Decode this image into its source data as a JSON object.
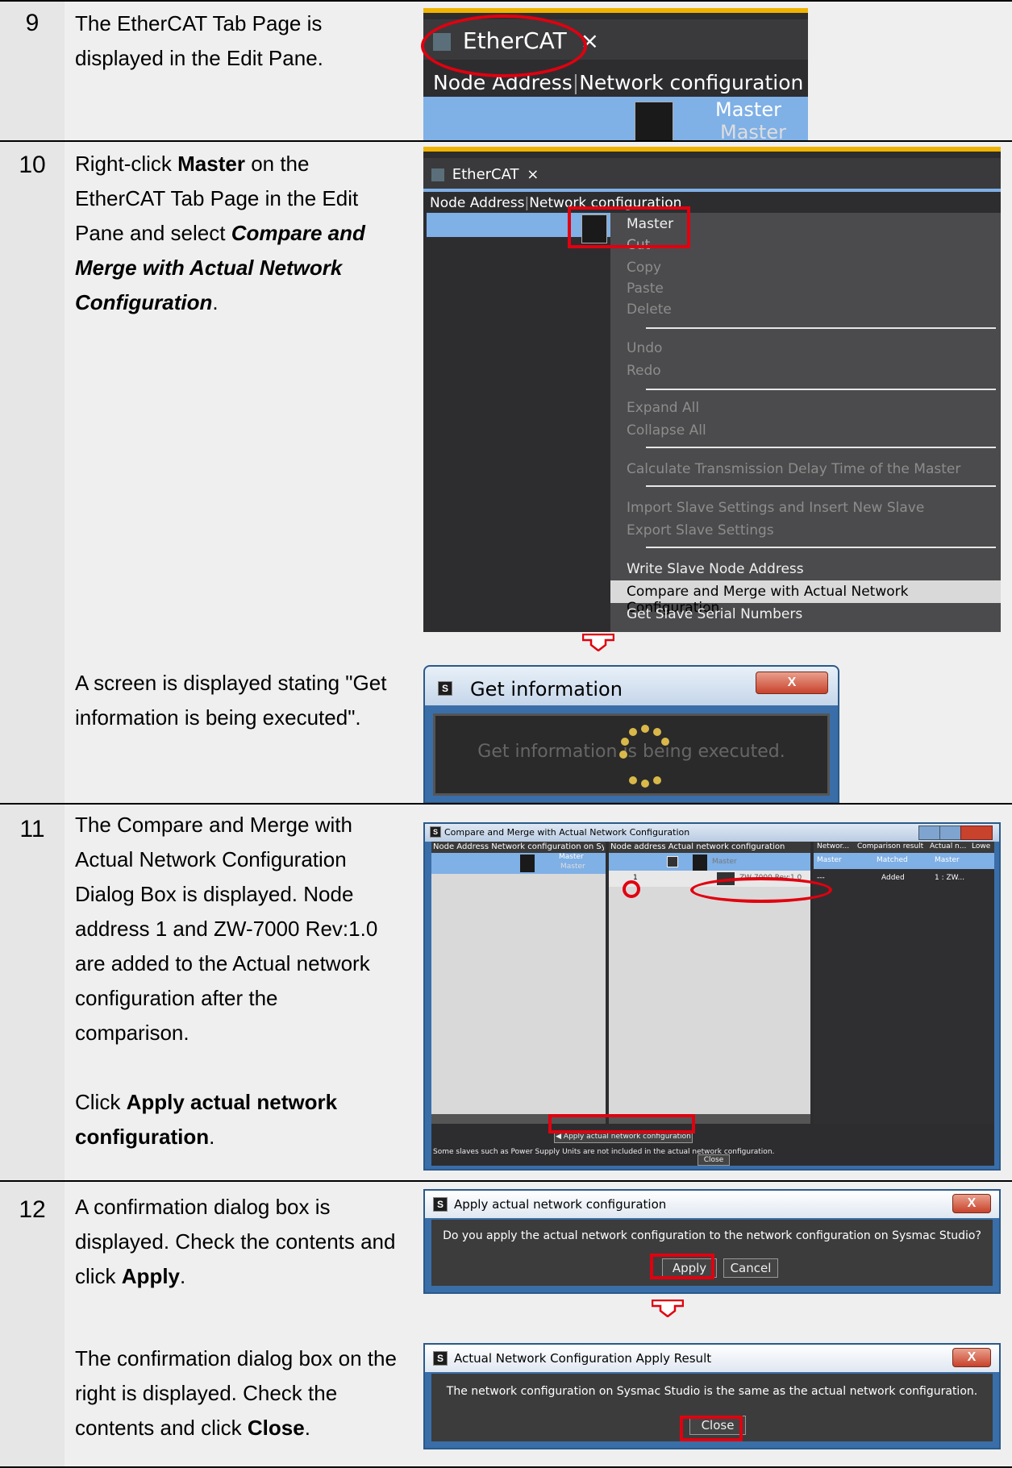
{
  "steps": [
    {
      "number": "9",
      "text_parts": [
        {
          "t": "The EtherCAT Tab Page is displayed in the Edit Pane."
        }
      ]
    },
    {
      "number": "10",
      "text_parts": [
        {
          "t": "Right-click "
        },
        {
          "t": "Master",
          "s": "b"
        },
        {
          "t": " on the EtherCAT Tab Page in the Edit Pane and select "
        },
        {
          "t": "Compare and Merge with Actual Network Configuration",
          "s": "bi"
        },
        {
          "t": "."
        }
      ],
      "sub_text": "A screen is displayed stating \"Get information is being executed\"."
    },
    {
      "number": "11",
      "text_parts": [
        {
          "t": "The Compare and Merge with Actual Network Configuration Dialog Box is displayed. Node address 1 and ZW-7000 Rev:1.0 are added to the Actual network configuration after the comparison."
        }
      ],
      "sub_text_parts": [
        {
          "t": "Click "
        },
        {
          "t": "Apply actual network configuration",
          "s": "b"
        },
        {
          "t": "."
        }
      ]
    },
    {
      "number": "12",
      "text_parts": [
        {
          "t": "A confirmation dialog box is displayed. Check the contents and click "
        },
        {
          "t": "Apply",
          "s": "b"
        },
        {
          "t": "."
        }
      ],
      "sub_text_parts": [
        {
          "t": "The confirmation dialog box on the right is displayed. Check the contents and click "
        },
        {
          "t": "Close",
          "s": "b"
        },
        {
          "t": "."
        }
      ]
    }
  ],
  "shot9": {
    "tab_label": "EtherCAT",
    "tab_close": "×",
    "col_node": "Node Address",
    "col_net": "Network configuration",
    "master1": "Master",
    "master2": "Master"
  },
  "shot10": {
    "tab_label": "EtherCAT",
    "tab_close": "×",
    "col_node": "Node Address",
    "col_net": "Network configuration",
    "menu": [
      "Master",
      "Cut",
      "Copy",
      "Paste",
      "Delete",
      "Undo",
      "Redo",
      "Expand All",
      "Collapse All",
      "Calculate Transmission Delay Time of the Master",
      "Import Slave Settings and Insert New Slave",
      "Export Slave Settings",
      "Write Slave Node Address",
      "Compare and Merge with Actual Network Configuration",
      "Get Slave Serial Numbers"
    ]
  },
  "get_info": {
    "title": "Get information",
    "message": "Get information is being executed.",
    "close": "X"
  },
  "compare": {
    "title": "Compare and Merge with Actual Network Configuration",
    "left_header": "Node Address Network configuration on Sysm",
    "left_master1": "Master",
    "left_master2": "Master",
    "mid_header": "Node address Actual network configuration",
    "mid_master": "Master",
    "node_num": "1",
    "device": "ZW-7000 Rev:1.0",
    "right_headers": [
      "Networ...",
      "Comparison result",
      "Actual n...",
      "Lowe"
    ],
    "right_row1": [
      "Master",
      "Matched",
      "Master"
    ],
    "right_row2": [
      "---",
      "Added",
      "1 : ZW..."
    ],
    "apply_btn": "◀ Apply actual network configuration",
    "note": "Some slaves such as Power Supply Units are not included in the actual network configuration.",
    "close_btn": "Close"
  },
  "apply_dlg": {
    "title": "Apply actual network configuration",
    "message": "Do you apply the actual network configuration to the network configuration on Sysmac Studio?",
    "apply": "Apply",
    "cancel": "Cancel",
    "close": "X"
  },
  "result_dlg": {
    "title": "Actual Network Configuration Apply Result",
    "message": "The network configuration on Sysmac Studio is the same as the actual network configuration.",
    "close_btn": "Close",
    "close": "X"
  }
}
